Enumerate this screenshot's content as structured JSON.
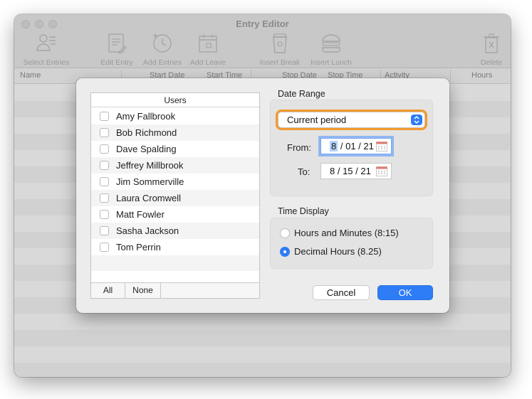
{
  "window": {
    "title": "Entry Editor"
  },
  "toolbar": {
    "select_entries": "Select Entries",
    "edit_entry": "Edit Entry",
    "add_entries": "Add Entries",
    "add_leave": "Add Leave",
    "insert_break": "Insert Break",
    "insert_lunch": "Insert Lunch",
    "delete": "Delete"
  },
  "table": {
    "columns": [
      "Name",
      "Start Date",
      "Start Time",
      "Stop Date",
      "Stop Time",
      "Activity",
      "Hours"
    ]
  },
  "dialog": {
    "users_header": "Users",
    "users": [
      {
        "name": "Amy Fallbrook",
        "checked": false
      },
      {
        "name": "Bob Richmond",
        "checked": false
      },
      {
        "name": "Dave Spalding",
        "checked": false
      },
      {
        "name": "Jeffrey Millbrook",
        "checked": false
      },
      {
        "name": "Jim Sommerville",
        "checked": false
      },
      {
        "name": "Laura Cromwell",
        "checked": false
      },
      {
        "name": "Matt Fowler",
        "checked": false
      },
      {
        "name": "Sasha Jackson",
        "checked": false
      },
      {
        "name": "Tom Perrin",
        "checked": false
      }
    ],
    "all_button": "All",
    "none_button": "None",
    "date_range_label": "Date Range",
    "period_select": "Current period",
    "from_label": "From:",
    "from_month": "8",
    "from_rest": "/ 01 / 21",
    "to_label": "To:",
    "to_date": "8 / 15 / 21",
    "time_display_label": "Time Display",
    "time_options": [
      {
        "label": "Hours and Minutes  (8:15)",
        "selected": false
      },
      {
        "label": "Decimal Hours  (8.25)",
        "selected": true
      }
    ],
    "cancel_button": "Cancel",
    "ok_button": "OK"
  },
  "colors": {
    "accent": "#2e7cf6",
    "focus_ring": "#f29a2e"
  }
}
